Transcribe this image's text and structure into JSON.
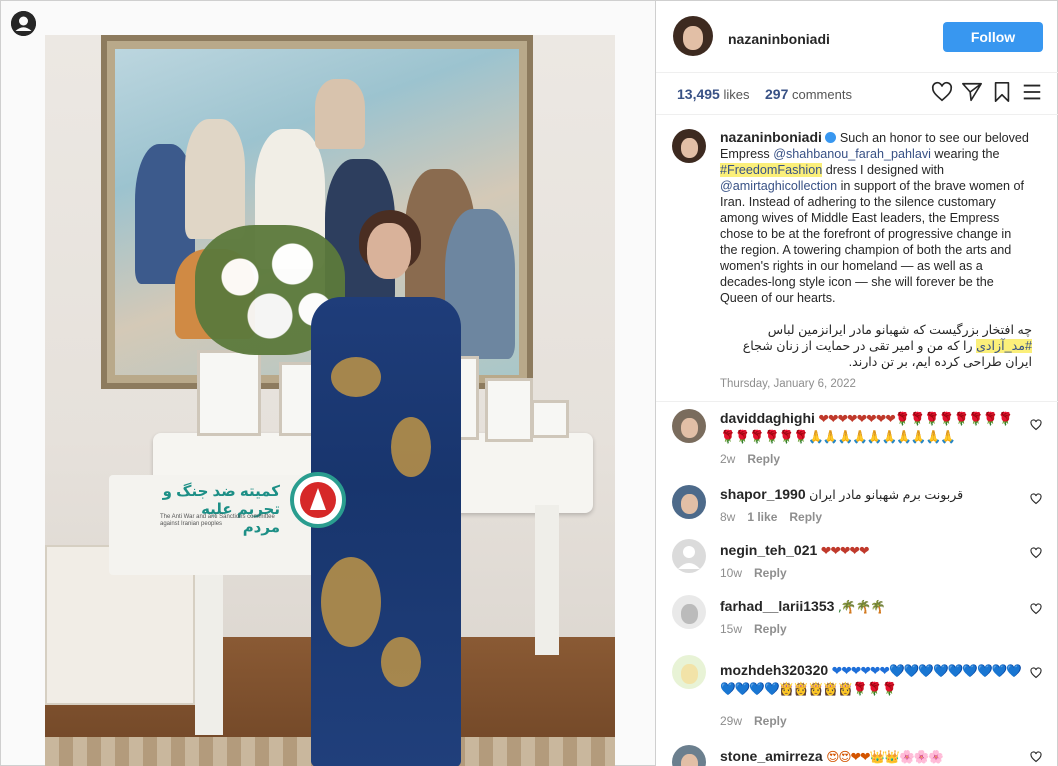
{
  "post": {
    "username": "nazaninboniadi",
    "follow_label": "Follow",
    "likes_count": "13,495",
    "likes_label": "likes",
    "comments_count": "297",
    "comments_label": "comments"
  },
  "caption": {
    "username": "nazaninboniadi",
    "t1": " Such an honor to see our beloved Empress ",
    "mention1": "@shahbanou_farah_pahlavi",
    "t2": " wearing the ",
    "hashtag1": "#FreedomFashion",
    "t3": " dress I designed with ",
    "mention2": "@amirtaghicollection",
    "t4": " in support of the brave women of Iran. Instead of adhering to the silence customary among wives of Middle East leaders, the Empress chose to be at the forefront of progressive change in the region. A towering champion of both the arts and women's rights in our homeland — as well as a decades-long style icon — she will forever be the Queen of our hearts.",
    "fa1": "چه افتخار بزرگیست که شهبانو مادر ایرانزمین لباس",
    "fa_hashtag": "#مد_آزادی",
    "fa2": " را که من و امیر تقی در حمایت از زنان شجاع",
    "fa3": "ایران طراحی کرده ایم، بر تن دارند.",
    "date": "Thursday, January 6, 2022"
  },
  "photo_watermark": {
    "title": "کمیته ضد جنگ و تحریم علیه مردم",
    "subtitle": "The Anti War and anti Sanctions committee against Iranian peoples"
  },
  "comments": [
    {
      "user": "daviddaghighi",
      "text": "❤❤❤❤❤❤❤❤🌹🌹🌹🌹🌹🌹🌹🌹🌹🌹🌹🌹🌹🌹🙏🙏🙏🙏🙏🙏🙏🙏🙏🙏",
      "time": "2w",
      "likes": "",
      "reply": "Reply"
    },
    {
      "user": "shapor_1990",
      "text": "قربونت برم شهبانو مادر ایران",
      "time": "8w",
      "likes": "1 like",
      "reply": "Reply"
    },
    {
      "user": "negin_teh_021",
      "text": "❤❤❤❤❤",
      "time": "10w",
      "likes": "",
      "reply": "Reply"
    },
    {
      "user": "farhad__larii1353",
      "text": ",🌴🌴🌴",
      "time": "15w",
      "likes": "",
      "reply": "Reply"
    },
    {
      "user": "mozhdeh320320",
      "text": "❤❤❤❤❤❤💙💙💙💙💙💙💙💙💙💙💙💙💙👸👸👸👸👸🌹🌹🌹",
      "time": "29w",
      "likes": "",
      "reply": "Reply"
    },
    {
      "user": "stone_amirreza",
      "text": "😍😍❤❤👑👑🌸🌸🌸",
      "time": "",
      "likes": "",
      "reply": ""
    }
  ],
  "colors": {
    "follow_button": "#3897f0",
    "link": "#385185",
    "hashtag_highlight": "#fbef7a"
  }
}
